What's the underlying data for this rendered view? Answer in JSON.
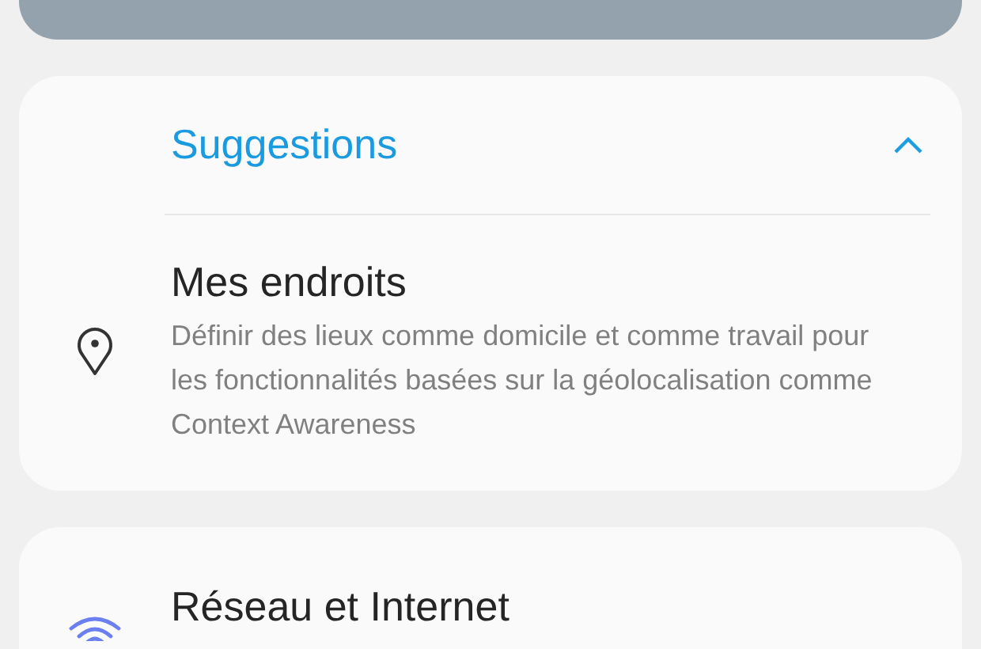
{
  "suggestions": {
    "title": "Suggestions",
    "expanded": true,
    "items": [
      {
        "kind": "location",
        "title": "Mes endroits",
        "description": "Définir des lieux comme domicile et comme travail pour les fonctionnalités basées sur la géolocalisation comme Context Awareness"
      }
    ]
  },
  "settings": [
    {
      "kind": "network",
      "title": "Réseau et Internet"
    }
  ]
}
